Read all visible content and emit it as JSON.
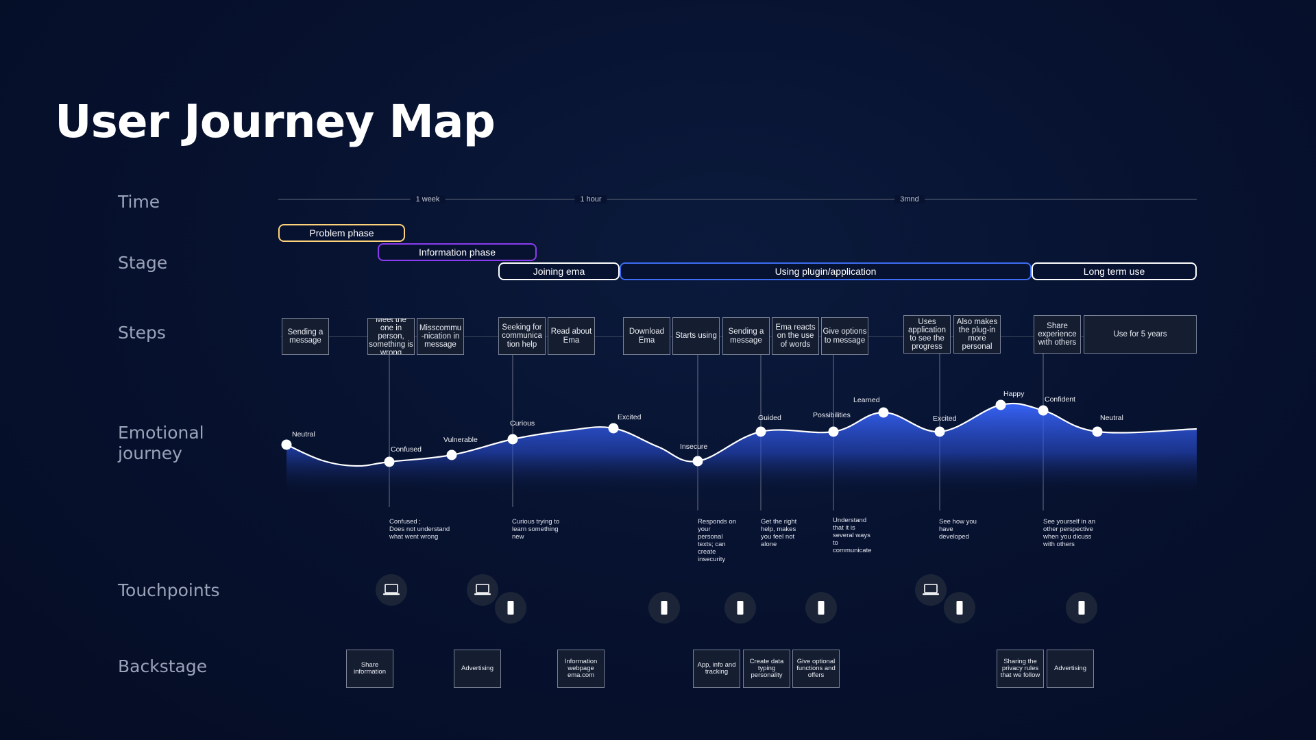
{
  "title": "User Journey Map",
  "rows": {
    "time": "Time",
    "stage": "Stage",
    "steps": "Steps",
    "emotional": "Emotional\njourney",
    "touchpoints": "Touchpoints",
    "backstage": "Backstage"
  },
  "time_ticks": [
    "1 week",
    "1 hour",
    "3mnd"
  ],
  "stages": [
    "Problem phase",
    "Information phase",
    "Joining ema",
    "Using plugin/application",
    "Long term use"
  ],
  "stage_colors": {
    "problem": "#ffd37a",
    "information": "#8b3cf0",
    "using": "#3d6df2",
    "default": "#ffffff"
  },
  "steps": [
    "Sending a message",
    "Meet the one in person, something is wrong",
    "Misscommu -nication in message",
    "Seeking for communica tion help",
    "Read about Ema",
    "Download Ema",
    "Starts using",
    "Sending a message",
    "Ema reacts on the use of words",
    "Give options to message",
    "Uses application to see the progress",
    "Also makes the plug-in more personal",
    "Share experience with others",
    "Use for 5 years"
  ],
  "emotions": [
    "Neutral",
    "Confused",
    "Vulnerable",
    "Curious",
    "Excited",
    "Insecure",
    "Guided",
    "Possibilities",
    "Learned",
    "Excited",
    "Happy",
    "Confident",
    "Neutral"
  ],
  "emotion_notes": [
    "Confused ;\nDoes not understand\nwhat went wrong",
    "Curious trying to\nlearn something\nnew",
    "Responds on\nyour\npersonal\ntexts;  can\ncreate\ninsecurity",
    "Get the right\nhelp, makes\nyou feel not\nalone",
    "Understand\nthat it is\nseveral ways\nto\ncommunicate",
    "See how you\nhave\ndeveloped",
    "See yourself in an\nother perspective\nwhen you dicuss\nwith others"
  ],
  "touchpoints": [
    {
      "icon": "laptop-icon"
    },
    {
      "icon": "laptop-icon"
    },
    {
      "icon": "phone-icon"
    },
    {
      "icon": "phone-icon"
    },
    {
      "icon": "phone-icon"
    },
    {
      "icon": "phone-icon"
    },
    {
      "icon": "laptop-icon"
    },
    {
      "icon": "phone-icon"
    },
    {
      "icon": "phone-icon"
    }
  ],
  "backstage": [
    "Share information",
    "Advertising",
    "Information webpage ema.com",
    "App, info and tracking",
    "Create data typing personality",
    "Give optional functions and offers",
    "Sharing the  privacy rules that we follow",
    "Advertising"
  ],
  "colors": {
    "curve_fill": "#2f5bf0",
    "curve_line": "#ffffff"
  }
}
